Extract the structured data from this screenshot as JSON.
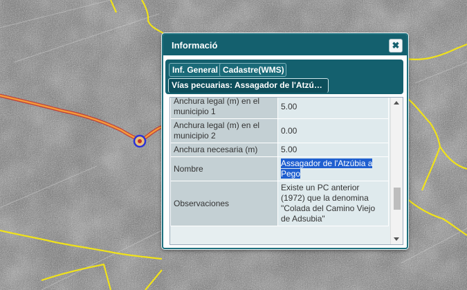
{
  "dialog": {
    "title": "Informació",
    "close_label": "✖"
  },
  "tabs": [
    {
      "label": "Inf. General"
    },
    {
      "label": "Cadastre(WMS)"
    },
    {
      "label": "Vías pecuarias: Assagador de l'Atzúbia..."
    }
  ],
  "rows": [
    {
      "label": "Anchura legal (m) en el municipio 1",
      "value": "5.00"
    },
    {
      "label": "Anchura legal (m) en el municipio 2",
      "value": "0.00"
    },
    {
      "label": "Anchura necesaria (m)",
      "value": "5.00"
    },
    {
      "label": "Nombre",
      "value": "Assagador de l'Atzúbia a Pego"
    },
    {
      "label": "Observaciones",
      "value": "Existe un PC anterior (1972) que la denomina \"Colada del Camino Viejo de Adsubia\""
    }
  ],
  "colors": {
    "route_highlight": "#f26a1b",
    "roads": "#f0e21a",
    "dialog_header": "#14606e",
    "selection": "#1e5fd0"
  }
}
